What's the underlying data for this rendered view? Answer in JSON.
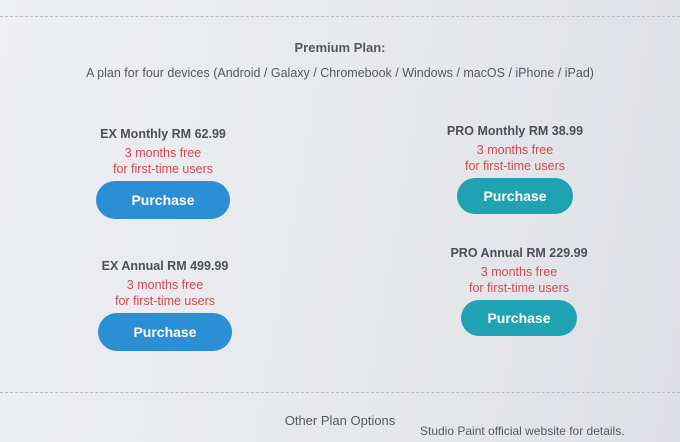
{
  "premium": {
    "title": "Premium Plan:",
    "subtitle": "A plan for four devices (Android / Galaxy / Chromebook / Windows / macOS / iPhone / iPad)"
  },
  "plans": [
    {
      "name": "EX Monthly RM 62.99",
      "offer_line1": "3 months free",
      "offer_line2": "for first-time users",
      "button": "Purchase"
    },
    {
      "name": "PRO Monthly RM 38.99",
      "offer_line1": "3 months free",
      "offer_line2": "for first-time users",
      "button": "Purchase"
    },
    {
      "name": "EX Annual RM 499.99",
      "offer_line1": "3 months free",
      "offer_line2": "for first-time users",
      "button": "Purchase"
    },
    {
      "name": "PRO Annual RM 229.99",
      "offer_line1": "3 months free",
      "offer_line2": "for first-time users",
      "button": "Purchase"
    }
  ],
  "other_plans": {
    "heading": "Other Plan Options",
    "partial_text": "Studio Paint official website for details."
  },
  "colors": {
    "ex_button": "#2a8fd5",
    "pro_button": "#1fa3b3",
    "offer_text": "#d1474e"
  }
}
